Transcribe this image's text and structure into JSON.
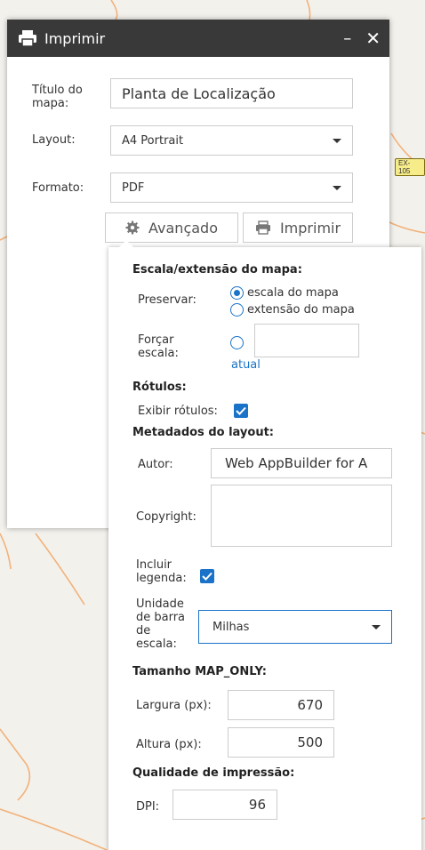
{
  "map": {
    "road_label": "EX-105"
  },
  "panel": {
    "title": "Imprimir",
    "minimize_symbol": "–",
    "close_symbol": "✕",
    "title_label": "Título do mapa:",
    "title_value": "Planta de Localização",
    "layout_label": "Layout:",
    "layout_value": "A4 Portrait",
    "format_label": "Formato:",
    "format_value": "PDF",
    "advanced_button": "Avançado",
    "print_button": "Imprimir"
  },
  "advanced": {
    "scale_section": "Escala/extensão do mapa:",
    "preserve_label": "Preservar:",
    "preserve_options": [
      {
        "label": "escala do mapa",
        "selected": true
      },
      {
        "label": "extensão do mapa",
        "selected": false
      }
    ],
    "force_scale_label": "Forçar escala:",
    "force_scale_value": "",
    "current_link": "atual",
    "labels_section": "Rótulos:",
    "show_labels": "Exibir rótulos:",
    "show_labels_checked": true,
    "metadata_section": "Metadados do layout:",
    "author_label": "Autor:",
    "author_value": "Web AppBuilder for A",
    "copyright_label": "Copyright:",
    "copyright_value": "",
    "legend_label": "Incluir legenda:",
    "legend_checked": true,
    "scalebar_label": "Unidade de barra de escala:",
    "scalebar_value": "Milhas",
    "map_only_section": "Tamanho MAP_ONLY:",
    "width_label": "Largura (px):",
    "width_value": "670",
    "height_label": "Altura (px):",
    "height_value": "500",
    "quality_section": "Qualidade de impressão:",
    "dpi_label": "DPI:",
    "dpi_value": "96"
  },
  "colors": {
    "accent": "#1a73c8",
    "titlebar": "#393939",
    "road": "#f0a868"
  }
}
